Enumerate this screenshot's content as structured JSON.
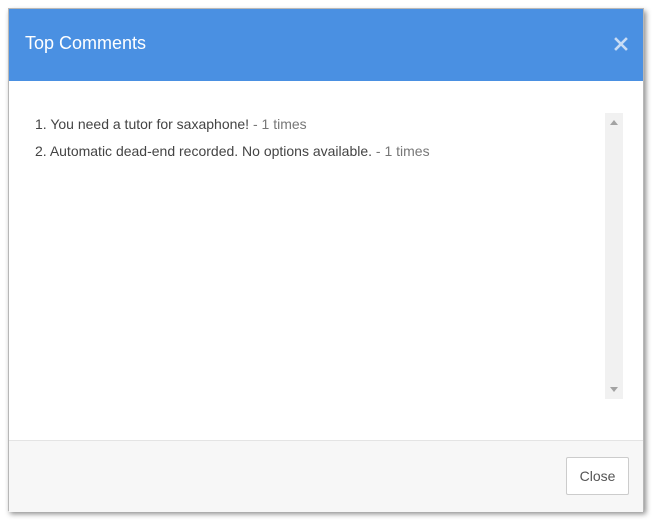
{
  "dialog": {
    "title": "Top Comments",
    "close_icon": "close-icon"
  },
  "comments": [
    {
      "number": "1.",
      "text": "You need a tutor for saxaphone!",
      "count": "- 1 times"
    },
    {
      "number": "2.",
      "text": "Automatic dead-end recorded. No options available.",
      "count": "- 1 times"
    }
  ],
  "footer": {
    "close_label": "Close"
  },
  "colors": {
    "header_bg": "#4a90e2",
    "footer_bg": "#f7f7f7",
    "text": "#444444"
  }
}
